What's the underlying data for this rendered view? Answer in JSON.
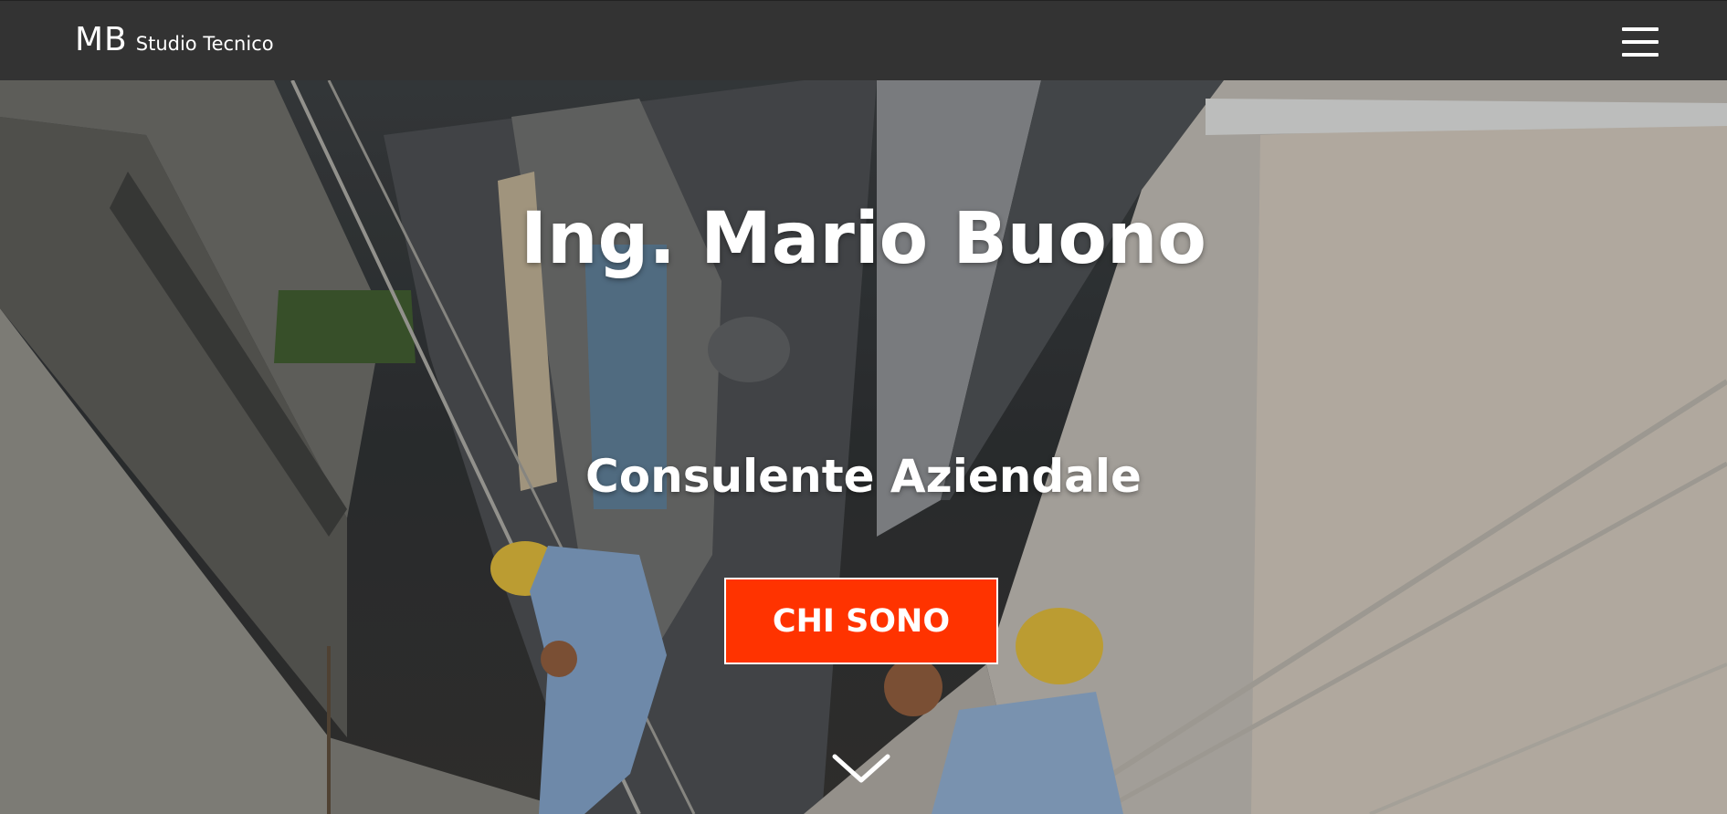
{
  "navbar": {
    "brand_mark": "MB",
    "brand_sub": "Studio Tecnico",
    "menu_icon": "hamburger-menu-icon",
    "background": "#333333"
  },
  "hero": {
    "title": "Ing. Mario Buono",
    "subtitle": "Consulente Aziendale",
    "cta_label": "CHI SONO",
    "cta_color": "#ff3300",
    "scroll_icon": "chevron-down-icon"
  }
}
